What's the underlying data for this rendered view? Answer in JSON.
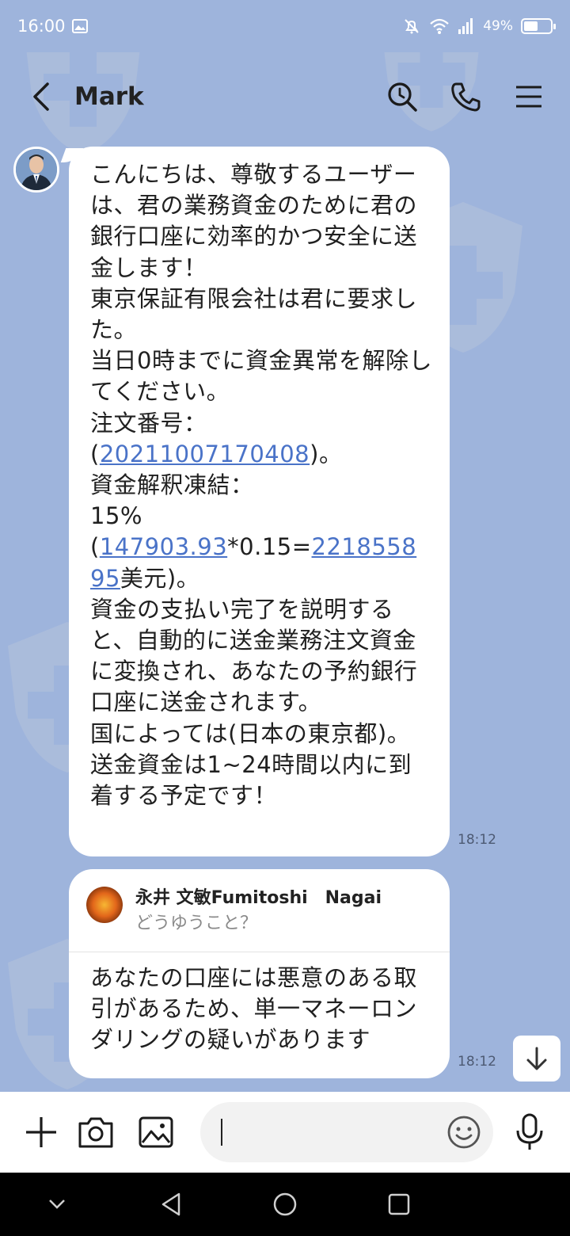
{
  "status_bar": {
    "time": "16:00",
    "battery": "49%",
    "battery_level": 0.49
  },
  "header": {
    "title": "Mark",
    "icons": [
      "back-icon",
      "search-icon",
      "phone-icon",
      "menu-icon"
    ]
  },
  "messages": [
    {
      "sender": "Mark",
      "time": "18:12",
      "segments": [
        {
          "text": "こんにちは、尊敬するユーザーは、君の業務資金のために君の銀行口座に効率的かつ安全に送金します！\n東京保証有限会社は君に要求した。\n当日0時までに資金異常を解除してください。\n注文番号：\n("
        },
        {
          "text": "20211007170408",
          "link": true
        },
        {
          "text": ")。\n資金解釈凍結：\n15%("
        },
        {
          "text": "147903.93",
          "link": true
        },
        {
          "text": "*0.15="
        },
        {
          "text": "2218558 95",
          "link": true
        },
        {
          "text": "美元)。\n資金の支払い完了を説明すると、自動的に送金業務注文資金に変換され、あなたの予約銀行口座に送金されます。\n国によっては(日本の東京都)。\n送金資金は1~24時間以内に到着する予定です！"
        }
      ]
    },
    {
      "sender": "Mark",
      "time": "18:12",
      "reply_to": {
        "name": "永井 文敏Fumitoshi　Nagai",
        "quote": "どうゆうこと？"
      },
      "text": "あなたの口座には悪意のある取引があるため、単一マネーロンダリングの疑いがあります"
    }
  ],
  "input_bar": {
    "placeholder": "",
    "icons": [
      "plus-icon",
      "camera-icon",
      "image-icon",
      "emoji-icon",
      "microphone-icon"
    ]
  },
  "colors": {
    "background": "#9eb4dc",
    "bubble": "#ffffff",
    "link": "#4a73c8"
  }
}
